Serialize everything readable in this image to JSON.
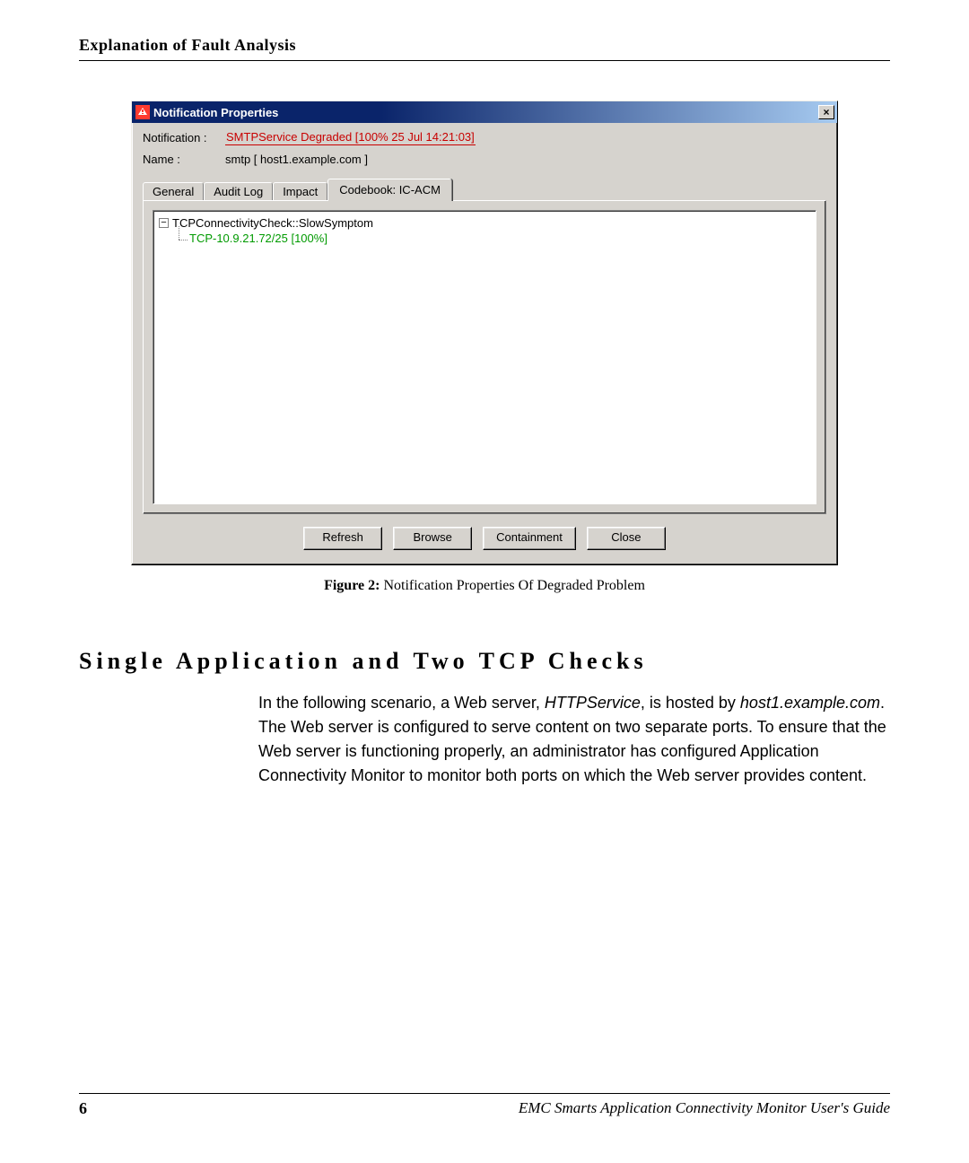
{
  "header": {
    "title": "Explanation of Fault Analysis"
  },
  "dialog": {
    "title": "Notification Properties",
    "notification_label": "Notification :",
    "notification_value": "SMTPService Degraded  [100% 25 Jul 14:21:03]",
    "name_label": "Name :",
    "name_value": "smtp  [ host1.example.com ]",
    "tabs": {
      "general": "General",
      "audit_log": "Audit Log",
      "impact": "Impact",
      "codebook": "Codebook: IC-ACM"
    },
    "tree": {
      "toggle_glyph": "−",
      "root": "TCPConnectivityCheck::SlowSymptom",
      "child": "TCP-10.9.21.72/25 [100%]"
    },
    "buttons": {
      "refresh": "Refresh",
      "browse": "Browse",
      "containment": "Containment",
      "close": "Close"
    },
    "close_glyph": "×"
  },
  "figure": {
    "label": "Figure 2:",
    "caption": "Notification Properties Of Degraded Problem"
  },
  "section": {
    "heading": "Single Application and Two TCP Checks",
    "para_pre": "In the following scenario, a Web server, ",
    "service_name": "HTTPService",
    "para_mid1": ", is hosted by ",
    "host_name": "host1.example.com",
    "para_post": ". The Web server is configured to serve content on two separate ports. To ensure that the Web server is functioning properly, an administrator has configured Application Connectivity Monitor to monitor both ports on which the Web server provides content."
  },
  "footer": {
    "page_number": "6",
    "guide_title": "EMC Smarts Application Connectivity Monitor User's Guide"
  }
}
